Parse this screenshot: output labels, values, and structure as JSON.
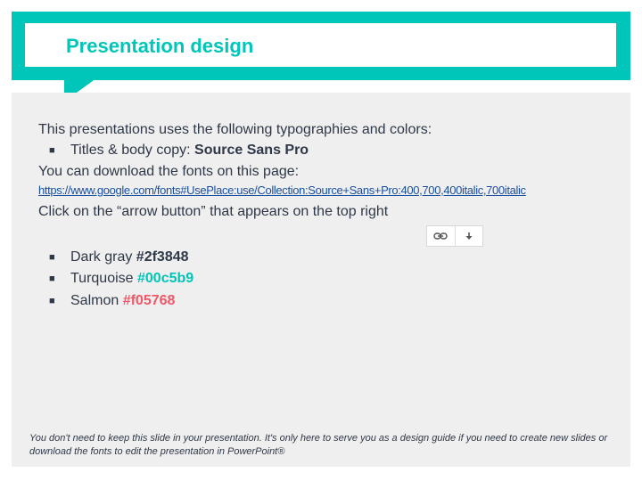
{
  "header": {
    "title": "Presentation design"
  },
  "intro": {
    "line1": "This presentations uses the following typographies and colors:",
    "bullet_marker": "■",
    "fonts_label": "Titles & body copy: ",
    "fonts_value": "Source Sans Pro",
    "download_text": "You can download the fonts on this page:",
    "link": "https://www.google.com/fonts#UsePlace:use/Collection:Source+Sans+Pro:400,700,400italic,700italic",
    "arrow_instruction": "Click on the “arrow button” that appears on the top right"
  },
  "toolbar": {
    "link_icon": "link-icon",
    "download_icon": "download-arrow-icon"
  },
  "colors": [
    {
      "label": "Dark gray ",
      "hex": "#2f3848",
      "color": "#2f3848"
    },
    {
      "label": "Turquoise ",
      "hex": "#00c5b9",
      "color": "#00c5b9"
    },
    {
      "label": "Salmon ",
      "hex": "#f05768",
      "color": "#f05768"
    }
  ],
  "footnote": "You don't need to keep this slide in your presentation. It's only here to serve you as a design guide if you need to create new slides or download the fonts to edit the presentation in PowerPoint®"
}
